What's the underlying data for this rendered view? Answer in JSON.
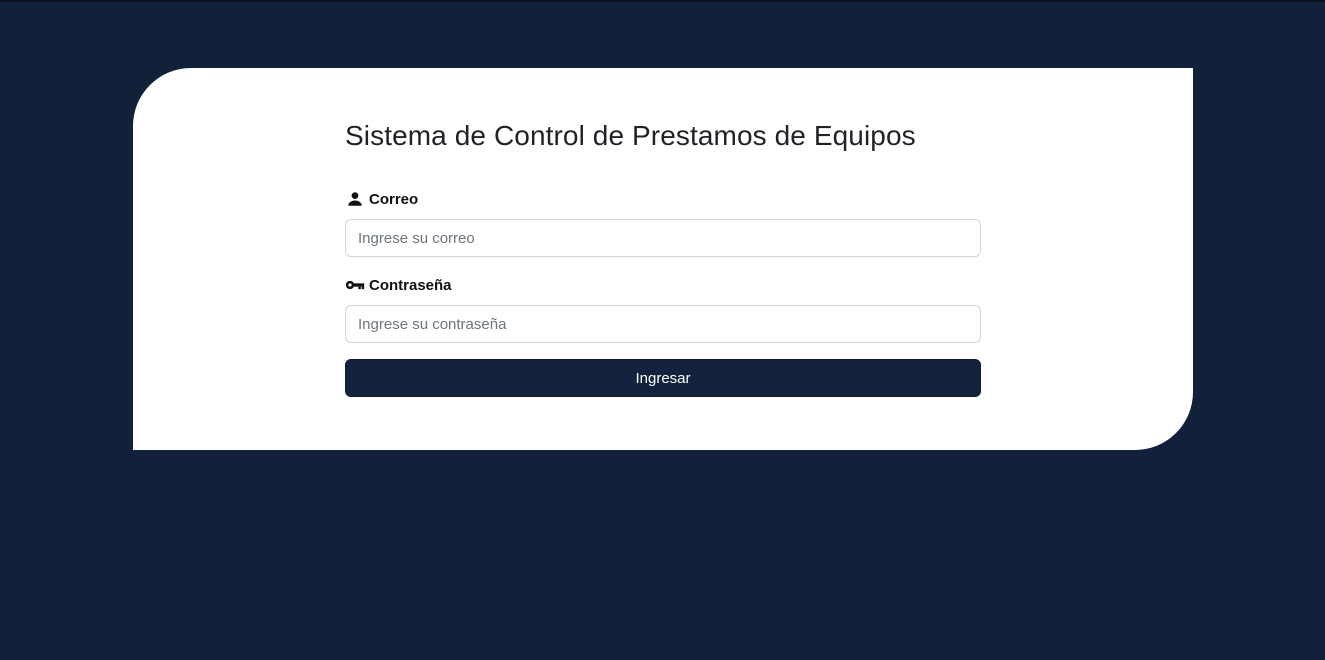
{
  "login": {
    "title": "Sistema de Control de Prestamos de Equipos",
    "email": {
      "icon": "person-icon",
      "label": "Correo",
      "placeholder": "Ingrese su correo",
      "value": ""
    },
    "password": {
      "icon": "key-icon",
      "label": "Contraseña",
      "placeholder": "Ingrese su contraseña",
      "value": ""
    },
    "submit_label": "Ingresar"
  },
  "colors": {
    "background": "#11213a",
    "card": "#ffffff",
    "button": "#13233d",
    "button_text": "#ffffff"
  }
}
